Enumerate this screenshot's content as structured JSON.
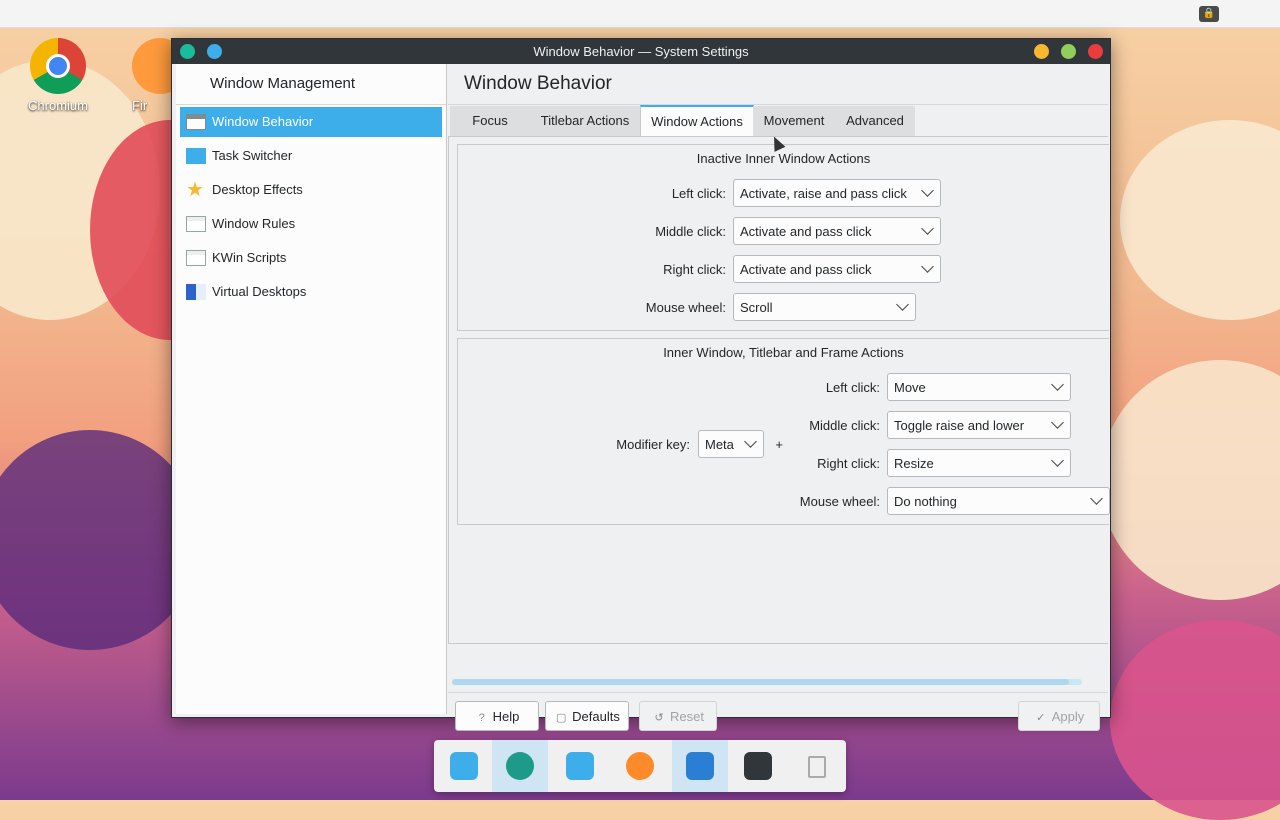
{
  "desktop": {
    "icons": [
      {
        "label": "Chromium"
      },
      {
        "label": "Fir"
      }
    ]
  },
  "window": {
    "title": "Window Behavior — System Settings",
    "sidebar": {
      "header": "Window Management",
      "items": [
        {
          "label": "Window Behavior",
          "icon": "window-icon",
          "active": true
        },
        {
          "label": "Task Switcher",
          "icon": "task-switcher-icon"
        },
        {
          "label": "Desktop Effects",
          "icon": "star-icon"
        },
        {
          "label": "Window Rules",
          "icon": "window-rules-icon"
        },
        {
          "label": "KWin Scripts",
          "icon": "kwin-scripts-icon"
        },
        {
          "label": "Virtual Desktops",
          "icon": "virtual-desktops-icon"
        }
      ]
    },
    "content": {
      "title": "Window Behavior",
      "tabs": [
        {
          "label": "Focus"
        },
        {
          "label": "Titlebar Actions"
        },
        {
          "label": "Window Actions",
          "active": true
        },
        {
          "label": "Movement"
        },
        {
          "label": "Advanced"
        }
      ],
      "inactive_group": {
        "title": "Inactive Inner Window Actions",
        "rows": [
          {
            "label": "Left click:",
            "value": "Activate, raise and pass click"
          },
          {
            "label": "Middle click:",
            "value": "Activate and pass click"
          },
          {
            "label": "Right click:",
            "value": "Activate and pass click"
          },
          {
            "label": "Mouse wheel:",
            "value": "Scroll"
          }
        ]
      },
      "frame_group": {
        "title": "Inner Window, Titlebar and Frame Actions",
        "modifier_label": "Modifier key:",
        "modifier_value": "Meta",
        "plus": "+",
        "rows": [
          {
            "label": "Left click:",
            "value": "Move"
          },
          {
            "label": "Middle click:",
            "value": "Toggle raise and lower"
          },
          {
            "label": "Right click:",
            "value": "Resize"
          },
          {
            "label": "Mouse wheel:",
            "value": "Do nothing"
          }
        ]
      },
      "scroll_progress": 0.98,
      "buttons": {
        "help": "Help",
        "defaults": "Defaults",
        "reset": "Reset",
        "apply": "Apply"
      }
    }
  },
  "colors": {
    "accent": "#3daee9",
    "titlebar": "#31363b"
  },
  "dock": {
    "items": [
      {
        "icon": "kde-launcher-icon"
      },
      {
        "icon": "system-settings-icon",
        "active": true
      },
      {
        "icon": "discover-icon"
      },
      {
        "icon": "firefox-icon"
      },
      {
        "icon": "file-manager-icon",
        "active": true
      },
      {
        "icon": "terminal-icon"
      },
      {
        "icon": "trash-icon"
      }
    ]
  }
}
